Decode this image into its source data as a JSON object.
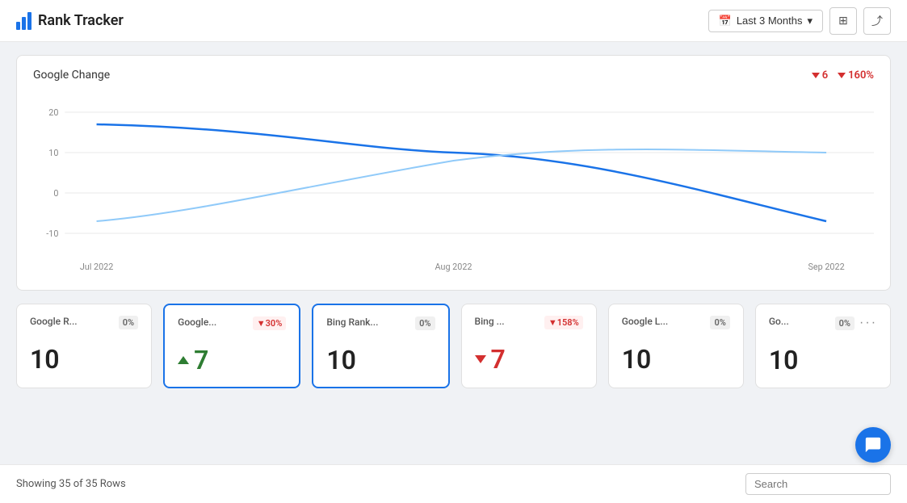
{
  "header": {
    "title": "Rank Tracker",
    "date_range_label": "Last 3 Months",
    "filter_icon": "filter-icon",
    "share_icon": "share-icon",
    "calendar_icon": "calendar-icon"
  },
  "chart": {
    "title": "Google Change",
    "stat1_value": "6",
    "stat2_value": "160%",
    "y_labels": [
      "20",
      "10",
      "0",
      "-10"
    ],
    "x_labels": [
      "Jul 2022",
      "Aug 2022",
      "Sep 2022"
    ]
  },
  "cards": [
    {
      "id": 1,
      "name": "Google R...",
      "badge": "0%",
      "badge_type": "neutral",
      "value": "10",
      "value_type": "normal",
      "active": false
    },
    {
      "id": 2,
      "name": "Google...",
      "badge": "▼30%",
      "badge_type": "red",
      "value": "7",
      "value_type": "green",
      "active": true
    },
    {
      "id": 3,
      "name": "Bing Rank...",
      "badge": "0%",
      "badge_type": "neutral",
      "value": "10",
      "value_type": "normal",
      "active": true
    },
    {
      "id": 4,
      "name": "Bing ...",
      "badge": "▼158%",
      "badge_type": "red",
      "value": "7",
      "value_type": "red",
      "active": false
    },
    {
      "id": 5,
      "name": "Google L...",
      "badge": "0%",
      "badge_type": "neutral",
      "value": "10",
      "value_type": "normal",
      "active": false
    },
    {
      "id": 6,
      "name": "Go...",
      "badge": "0%",
      "badge_type": "neutral",
      "value": "10",
      "value_type": "normal",
      "active": false,
      "has_more": true
    }
  ],
  "footer": {
    "rows_text": "Showing 35 of 35 Rows",
    "search_placeholder": "Search"
  }
}
